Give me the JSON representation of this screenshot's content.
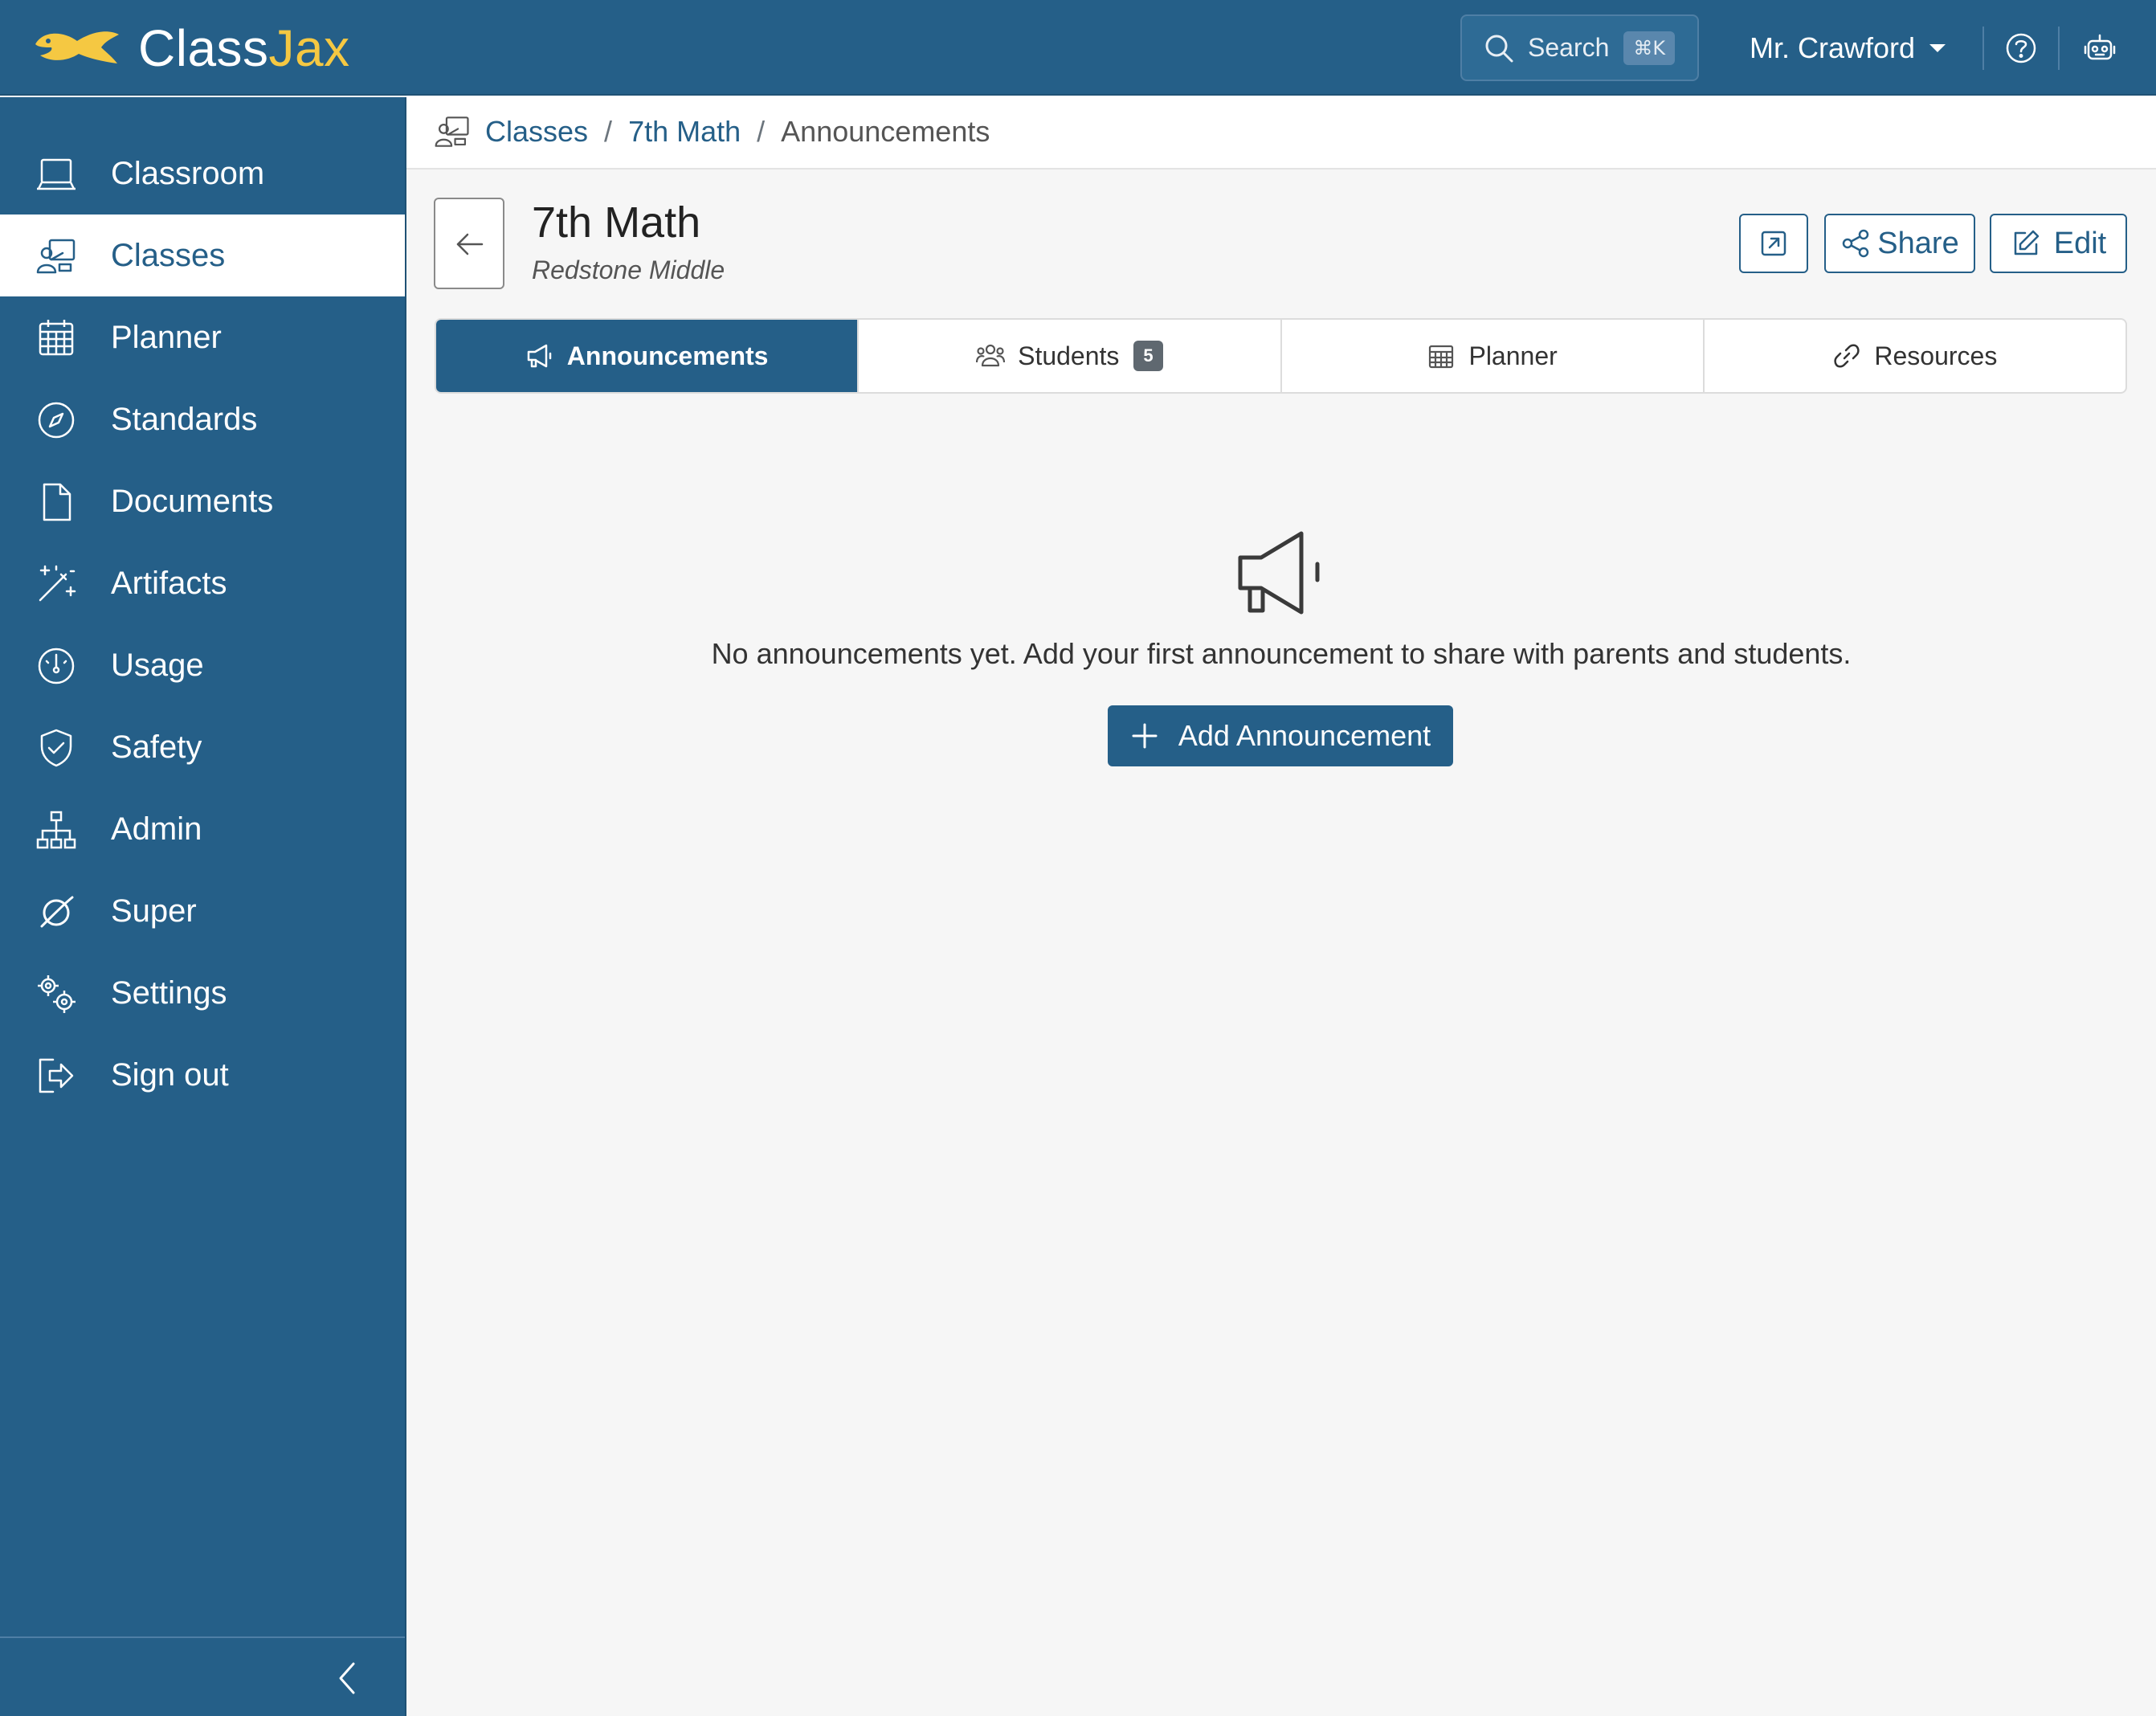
{
  "brand": {
    "name_part1": "Class",
    "name_part2": "Jax",
    "logo_icon": "fish-icon"
  },
  "topbar": {
    "search_label": "Search",
    "search_shortcut": "⌘K",
    "user_name": "Mr. Crawford",
    "help_icon": "help-circle-icon",
    "assistant_icon": "robot-icon"
  },
  "sidebar": {
    "items": [
      {
        "label": "Classroom",
        "icon": "laptop-icon"
      },
      {
        "label": "Classes",
        "icon": "teacher-board-icon",
        "active": true
      },
      {
        "label": "Planner",
        "icon": "calendar-grid-icon"
      },
      {
        "label": "Standards",
        "icon": "compass-icon"
      },
      {
        "label": "Documents",
        "icon": "document-icon"
      },
      {
        "label": "Artifacts",
        "icon": "magic-wand-icon"
      },
      {
        "label": "Usage",
        "icon": "gauge-icon"
      },
      {
        "label": "Safety",
        "icon": "shield-check-icon"
      },
      {
        "label": "Admin",
        "icon": "org-chart-icon"
      },
      {
        "label": "Super",
        "icon": "orbit-icon"
      },
      {
        "label": "Settings",
        "icon": "gears-icon"
      },
      {
        "label": "Sign out",
        "icon": "sign-out-icon"
      }
    ],
    "collapse_icon": "chevron-left-icon"
  },
  "breadcrumb": {
    "items": [
      "Classes",
      "7th Math"
    ],
    "current": "Announcements",
    "separator": "/"
  },
  "header": {
    "title": "7th Math",
    "subtitle": "Redstone Middle",
    "share_label": "Share",
    "edit_label": "Edit"
  },
  "tabs": [
    {
      "label": "Announcements",
      "icon": "megaphone-icon",
      "active": true
    },
    {
      "label": "Students",
      "icon": "people-icon",
      "badge": "5"
    },
    {
      "label": "Planner",
      "icon": "calendar-icon"
    },
    {
      "label": "Resources",
      "icon": "link-icon"
    }
  ],
  "empty_state": {
    "icon": "megaphone-icon",
    "message": "No announcements yet. Add your first announcement to share with parents and students.",
    "button_label": "Add Announcement"
  },
  "colors": {
    "primary": "#255f88",
    "accent": "#f5c842",
    "background": "#f6f6f6"
  }
}
